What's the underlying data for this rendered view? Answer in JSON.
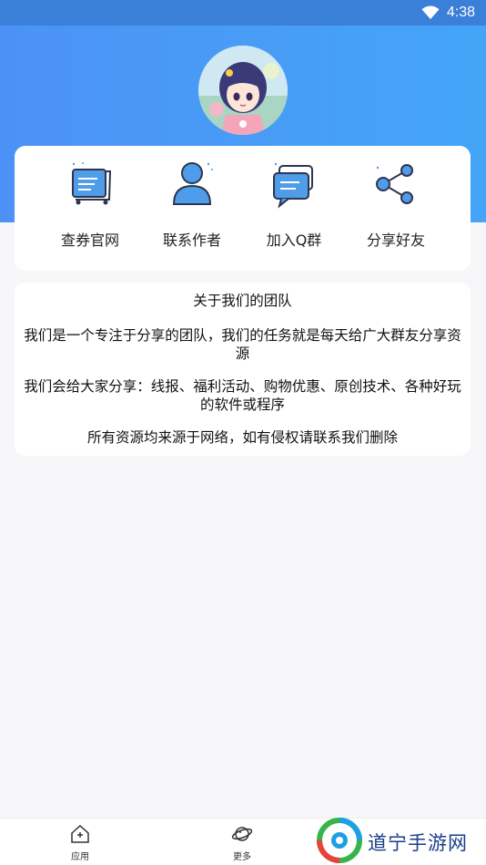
{
  "status_bar": {
    "time": "4:38",
    "wifi_icon": "wifi-icon"
  },
  "colors": {
    "header_gradient_start": "#4c92f6",
    "header_gradient_end": "#44a5f7",
    "icon_blue": "#4f9de8",
    "page_bg": "#f7f7f9"
  },
  "profile": {
    "avatar": "anime-girl-avatar"
  },
  "menu": {
    "items": [
      {
        "label": "查券官网",
        "icon": "cart-icon"
      },
      {
        "label": "联系作者",
        "icon": "user-icon"
      },
      {
        "label": "加入Q群",
        "icon": "chat-icon"
      },
      {
        "label": "分享好友",
        "icon": "share-icon"
      }
    ]
  },
  "about": {
    "title": "关于我们的团队",
    "paragraphs": [
      "我们是一个专注于分享的团队，我们的任务就是每天给广大群友分享资源",
      "我们会给大家分享：线报、福利活动、购物优惠、原创技术、各种好玩的软件或程序",
      "所有资源均来源于网络，如有侵权请联系我们删除"
    ]
  },
  "bottom_nav": {
    "items": [
      {
        "label": "应用",
        "icon": "home-icon"
      },
      {
        "label": "更多",
        "icon": "planet-icon"
      }
    ]
  },
  "watermark": {
    "text": "道宁手游网"
  }
}
